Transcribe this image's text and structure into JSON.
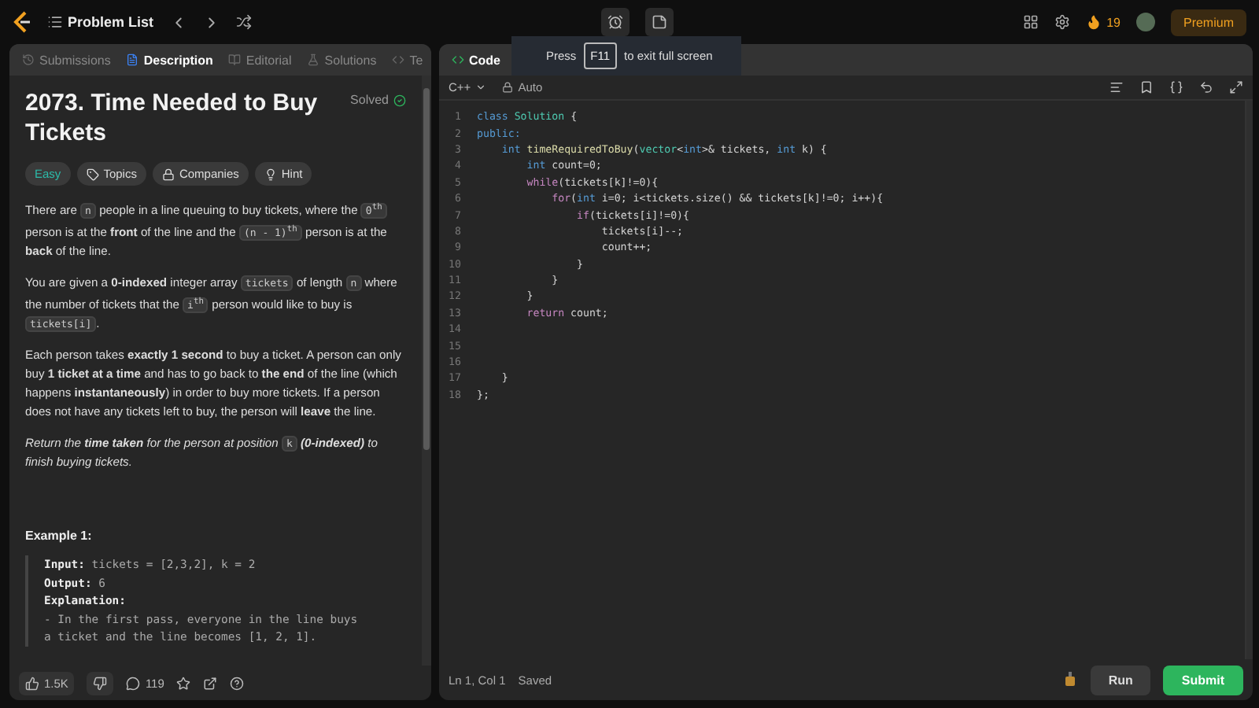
{
  "topbar": {
    "title": "Problem List",
    "streak": "19",
    "premium": "Premium"
  },
  "tooltip": {
    "before": "Press",
    "key": "F11",
    "after": "to exit full screen"
  },
  "left_tabs": [
    {
      "label": "Submissions",
      "selected": false
    },
    {
      "label": "Description",
      "selected": true
    },
    {
      "label": "Editorial",
      "selected": false
    },
    {
      "label": "Solutions",
      "selected": false
    },
    {
      "label": "Te",
      "selected": false
    }
  ],
  "problem": {
    "title": "2073. Time Needed to Buy Tickets",
    "status": "Solved",
    "difficulty": "Easy",
    "tags": [
      "Topics",
      "Companies",
      "Hint"
    ],
    "paragraphs": [
      [
        {
          "kind": "text",
          "text": "There are "
        },
        {
          "kind": "code",
          "text": "n"
        },
        {
          "kind": "text",
          "text": " people in a line queuing to buy tickets, where the "
        },
        {
          "kind": "code",
          "text": "0$^{th}$"
        },
        {
          "kind": "text",
          "text": " person is at the **front** of the line and the "
        },
        {
          "kind": "code",
          "text": "(n - 1)$^{th}$"
        },
        {
          "kind": "text",
          "text": " person is at the **back** of the line."
        }
      ],
      [
        {
          "kind": "text",
          "text": "You are given a **0-indexed** integer array "
        },
        {
          "kind": "code",
          "text": "tickets"
        },
        {
          "kind": "text",
          "text": " of length "
        },
        {
          "kind": "code",
          "text": "n"
        },
        {
          "kind": "text",
          "text": " where the number of tickets that the "
        },
        {
          "kind": "code",
          "text": "i$^{th}$"
        },
        {
          "kind": "text",
          "text": " person would like to buy is "
        },
        {
          "kind": "code",
          "text": "tickets[i]"
        },
        {
          "kind": "text",
          "text": "."
        }
      ],
      [
        {
          "kind": "text",
          "text": "Each person takes **exactly 1 second** to buy a ticket. A person can only buy **1 ticket at a time** and has to go back to **the end** of the line (which happens **instantaneously**) in order to buy more tickets. If a person does not have any tickets left to buy, the person will **leave** the line."
        }
      ],
      [
        {
          "kind": "em",
          "text": "Return the **time taken** for the person at position "
        },
        {
          "kind": "code",
          "text": "k"
        },
        {
          "kind": "em",
          "text": " **(0-indexed)** to finish buying tickets."
        }
      ]
    ],
    "example_title": "Example 1:",
    "example": [
      {
        "label": "Input:",
        "value": "tickets = [2,3,2], k = 2"
      },
      {
        "label": "Output:",
        "value": "6"
      },
      {
        "label": "Explanation:"
      }
    ],
    "example_text": [
      "- In the first pass, everyone in the line buys",
      "a ticket and the line becomes [1, 2, 1]."
    ]
  },
  "footer": {
    "likes": "1.5K",
    "comments": "119"
  },
  "code_tab": "Code",
  "editor": {
    "language": "C++",
    "mode": "Auto",
    "lines": [
      {
        "number": "1",
        "tokens": [
          {
            "kind": "kw",
            "text": "class "
          },
          {
            "kind": "type",
            "text": "Solution"
          },
          {
            "kind": "plain",
            "text": " {"
          }
        ]
      },
      {
        "number": "2",
        "tokens": [
          {
            "kind": "kw",
            "text": "public:"
          }
        ]
      },
      {
        "number": "3",
        "tokens": [
          {
            "kind": "kw",
            "text": "    int "
          },
          {
            "kind": "fn",
            "text": "timeRequiredToBuy"
          },
          {
            "kind": "plain",
            "text": "("
          },
          {
            "kind": "type",
            "text": "vector"
          },
          {
            "kind": "plain",
            "text": "<"
          },
          {
            "kind": "kw",
            "text": "int"
          },
          {
            "kind": "plain",
            "text": ">& tickets, "
          },
          {
            "kind": "kw",
            "text": "int"
          },
          {
            "kind": "plain",
            "text": " k) {"
          }
        ]
      },
      {
        "number": "4",
        "tokens": [
          {
            "kind": "kw",
            "text": "        int"
          },
          {
            "kind": "plain",
            "text": " count=0;"
          }
        ]
      },
      {
        "number": "5",
        "tokens": [
          {
            "kind": "ctl",
            "text": "        while"
          },
          {
            "kind": "plain",
            "text": "(tickets[k]!=0){"
          }
        ]
      },
      {
        "number": "6",
        "tokens": [
          {
            "kind": "ctl",
            "text": "            for"
          },
          {
            "kind": "plain",
            "text": "("
          },
          {
            "kind": "kw",
            "text": "int"
          },
          {
            "kind": "plain",
            "text": " i=0; i<tickets.size() && tickets[k]!=0; i++){"
          }
        ]
      },
      {
        "number": "7",
        "tokens": [
          {
            "kind": "ctl",
            "text": "                if"
          },
          {
            "kind": "plain",
            "text": "(tickets[i]!=0){"
          }
        ]
      },
      {
        "number": "8",
        "tokens": [
          {
            "kind": "plain",
            "text": "                    tickets[i]--;"
          }
        ]
      },
      {
        "number": "9",
        "tokens": [
          {
            "kind": "plain",
            "text": "                    count++;"
          }
        ]
      },
      {
        "number": "10",
        "tokens": [
          {
            "kind": "plain",
            "text": "                }"
          }
        ]
      },
      {
        "number": "11",
        "tokens": [
          {
            "kind": "plain",
            "text": "            }"
          }
        ]
      },
      {
        "number": "12",
        "tokens": [
          {
            "kind": "plain",
            "text": "        }"
          }
        ]
      },
      {
        "number": "13",
        "tokens": [
          {
            "kind": "ctl",
            "text": "        return"
          },
          {
            "kind": "plain",
            "text": " count;"
          }
        ]
      },
      {
        "number": "14"
      },
      {
        "number": "15"
      },
      {
        "number": "16"
      },
      {
        "number": "17",
        "tokens": [
          {
            "kind": "plain",
            "text": "    }"
          }
        ]
      },
      {
        "number": "18",
        "tokens": [
          {
            "kind": "plain",
            "text": "};"
          }
        ]
      }
    ]
  },
  "status_bar": {
    "position": "Ln 1, Col 1",
    "saved": "Saved"
  },
  "buttons": {
    "run": "Run",
    "submit": "Submit"
  }
}
